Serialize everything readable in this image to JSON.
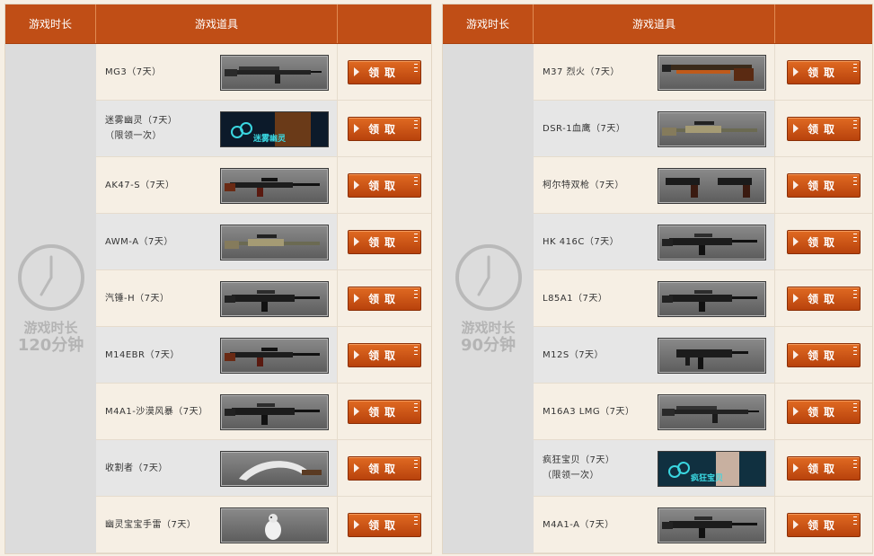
{
  "header": {
    "time_col": "游戏时长",
    "item_col": "游戏道具",
    "action_col": ""
  },
  "claim_label": "领取",
  "left": {
    "time_line1": "游戏时长",
    "time_line2": "120分钟",
    "items": [
      {
        "name": "MG3（7天）",
        "icon": "machine-gun-icon"
      },
      {
        "name": "迷雾幽灵（7天）\n（限领一次）",
        "icon": "ghost-character-icon",
        "banner": "迷雾幽灵"
      },
      {
        "name": "AK47-S（7天）",
        "icon": "rifle-icon"
      },
      {
        "name": "AWM-A（7天）",
        "icon": "sniper-rifle-icon"
      },
      {
        "name": "汽锤-H（7天）",
        "icon": "assault-rifle-icon"
      },
      {
        "name": "M14EBR（7天）",
        "icon": "rifle-icon"
      },
      {
        "name": "M4A1-沙漠风暴（7天）",
        "icon": "assault-rifle-icon"
      },
      {
        "name": "收割者（7天）",
        "icon": "machete-icon"
      },
      {
        "name": "幽灵宝宝手雷（7天）",
        "icon": "grenade-icon"
      }
    ]
  },
  "right": {
    "time_line1": "游戏时长",
    "time_line2": "90分钟",
    "items": [
      {
        "name": "M37 烈火（7天）",
        "icon": "shotgun-icon"
      },
      {
        "name": "DSR-1血鹰（7天）",
        "icon": "sniper-rifle-icon"
      },
      {
        "name": "柯尔特双枪（7天）",
        "icon": "pistols-icon"
      },
      {
        "name": "HK 416C（7天）",
        "icon": "assault-rifle-icon"
      },
      {
        "name": "L85A1（7天）",
        "icon": "assault-rifle-icon"
      },
      {
        "name": "M12S（7天）",
        "icon": "smg-icon"
      },
      {
        "name": "M16A3 LMG（7天）",
        "icon": "machine-gun-icon"
      },
      {
        "name": "疯狂宝贝（7天）\n（限领一次）",
        "icon": "character-icon",
        "banner": "疯狂宝贝"
      },
      {
        "name": "M4A1-A（7天）",
        "icon": "assault-rifle-icon"
      }
    ]
  }
}
